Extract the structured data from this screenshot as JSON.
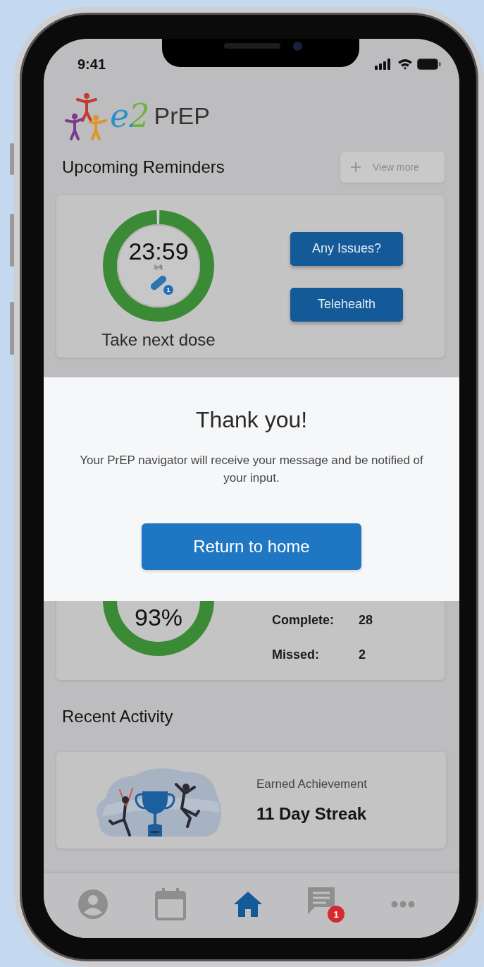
{
  "status_bar": {
    "time": "9:41"
  },
  "logo": {
    "mark": "e2",
    "name": "PrEP"
  },
  "reminders": {
    "title": "Upcoming Reminders",
    "view_more": "View more",
    "timer": {
      "time": "23:59",
      "caption": "left",
      "level": 0.99,
      "dose_count": "1"
    },
    "label": "Take next dose",
    "actions": [
      "Any Issues?",
      "Telehealth"
    ]
  },
  "dialog": {
    "title": "Thank you!",
    "message": "Your PrEP navigator will receive your message and be notified of your input.",
    "button": "Return to home"
  },
  "adherence": {
    "percent": "93%",
    "stats": [
      {
        "label": "Complete:",
        "value": "28"
      },
      {
        "label": "Missed:",
        "value": "2"
      }
    ]
  },
  "recent_activity": {
    "title": "Recent Activity",
    "items": [
      {
        "caption": "Earned Achievement",
        "title": "11 Day Streak"
      }
    ]
  },
  "nav": [
    {
      "kind": "profile",
      "selected": false
    },
    {
      "kind": "calendar",
      "selected": false
    },
    {
      "kind": "home",
      "selected": true
    },
    {
      "kind": "messages",
      "selected": false,
      "badge": "1"
    },
    {
      "kind": "more",
      "selected": false
    }
  ]
}
